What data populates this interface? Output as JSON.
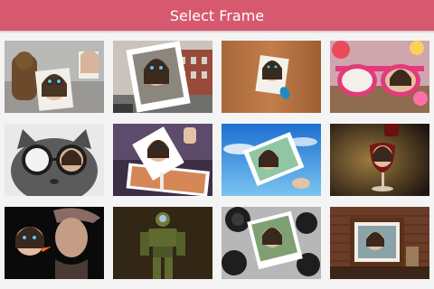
{
  "header": {
    "title": "Select Frame"
  },
  "frames": [
    {
      "name": "frame-dog-street"
    },
    {
      "name": "frame-city-street-photo"
    },
    {
      "name": "frame-wood-wall-note"
    },
    {
      "name": "frame-pink-sunglasses"
    },
    {
      "name": "frame-cat-glasses"
    },
    {
      "name": "frame-dusk-photo"
    },
    {
      "name": "frame-sky-photo"
    },
    {
      "name": "frame-wine-glass"
    },
    {
      "name": "frame-girl-bubble"
    },
    {
      "name": "frame-robot-armor"
    },
    {
      "name": "frame-camera-lens"
    },
    {
      "name": "frame-wall-picture"
    }
  ],
  "colors": {
    "header": "#d7596f",
    "background": "#f4f4f4"
  }
}
